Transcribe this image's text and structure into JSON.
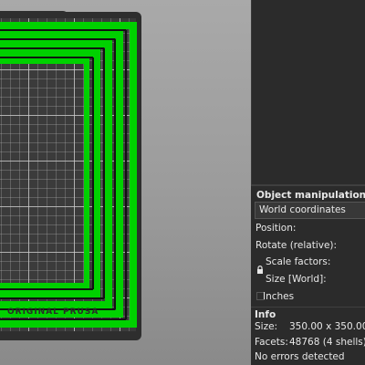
{
  "viewport": {
    "bed_label": "ORIGINAL PRUSA"
  },
  "object_manipulation": {
    "title": "Object manipulation",
    "coordinates_select": "World coordinates",
    "position_label": "Position:",
    "rotate_label": "Rotate (relative):",
    "scale_label": "Scale factors:",
    "size_label": "Size [World]:",
    "inches_label": "Inches",
    "inches_checked": false
  },
  "info": {
    "title": "Info",
    "size_label": "Size:",
    "size_value": "350.00 x 350.00 x",
    "facets_label": "Facets:",
    "facets_value": "48768 (4 shells)",
    "errors": "No errors detected"
  },
  "colors": {
    "panel_bg": "#2b2b2b",
    "model_green": "#00d100",
    "bed_dark": "#2e2e2e"
  }
}
